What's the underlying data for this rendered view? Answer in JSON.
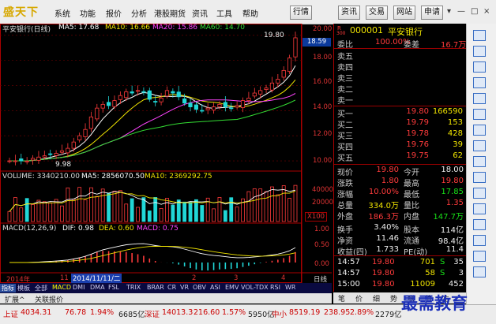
{
  "app": {
    "logo_text": "盛天下"
  },
  "menu": [
    "系统",
    "功能",
    "报价",
    "分析",
    "港股期货",
    "资讯",
    "工具",
    "帮助"
  ],
  "toolbar": [
    "行情",
    "资讯",
    "交易",
    "网站",
    "申请"
  ],
  "window_controls": [
    "▾",
    "—",
    "□",
    "×"
  ],
  "chart": {
    "title": "平安银行(日线)",
    "ma": [
      {
        "label": "MA5: 17.68",
        "color": "#ffffff"
      },
      {
        "label": "MA10: 16.66",
        "color": "#f0e400"
      },
      {
        "label": "MA20: 15.86",
        "color": "#ff44ff"
      },
      {
        "label": "MA60: 14.70",
        "color": "#33dd33"
      }
    ],
    "y_ticks": [
      "20.00",
      "18.00",
      "16.00",
      "14.00",
      "12.00",
      "10.00"
    ],
    "current_price_tag": "18.59",
    "high_mark": "19.80",
    "low_mark": "9.98",
    "volume_title": "VOLUME: 3340210.00",
    "volume_ma5": "MA5: 2856070.50",
    "volume_ma10": "MA10: 2369292.75",
    "volume_ticks": [
      "40000",
      "20000",
      "X100"
    ],
    "macd_title": "MACD(12,26,9)",
    "macd_dif": "DIF: 0.98",
    "macd_dea": "DEA: 0.60",
    "macd_val": "MACD: 0.75",
    "macd_ticks": [
      "1.00",
      "0.50",
      "0.00"
    ],
    "date_axis": [
      "2014年",
      "11",
      "2014/11/11/二",
      "2",
      "3",
      "4",
      "日线"
    ],
    "closes": [
      10.0,
      10.0,
      10.0,
      9.98,
      10.2,
      10.3,
      10.4,
      10.5,
      10.6,
      10.8,
      11.0,
      11.5,
      12.0,
      12.5,
      13.5,
      14.2,
      14.5,
      14.4,
      14.8,
      15.2,
      15.5,
      15.4,
      15.6,
      15.5,
      14.9,
      14.7,
      15.0,
      15.6,
      15.4,
      15.1,
      14.6,
      14.3,
      14.1,
      14.0,
      14.2,
      14.3,
      14.5,
      14.3,
      14.2,
      14.4,
      14.8,
      15.0,
      15.4,
      15.6,
      15.8,
      16.2,
      16.5,
      17.2,
      18.2,
      19.8
    ]
  },
  "tabs_bottom": [
    "指标",
    "模板",
    "全部",
    "MACD",
    "DMI",
    "DMA",
    "FSL",
    "TRIX",
    "BRAR",
    "CR",
    "VR",
    "OBV",
    "ASI",
    "EMV",
    "VOL-TDX",
    "RSI",
    "WR"
  ],
  "subtabs": [
    "扩展^",
    "关联报价"
  ],
  "quote": {
    "ratio_label": "委比",
    "ratio_value": "100.00%",
    "diff_label": "委差",
    "diff_value": "16.7万",
    "code_mark": "R",
    "code_num": "300",
    "code": "000001",
    "name": "平安银行",
    "sells": [
      {
        "label": "卖五"
      },
      {
        "label": "卖四"
      },
      {
        "label": "卖三"
      },
      {
        "label": "卖二"
      },
      {
        "label": "卖一"
      }
    ],
    "buys": [
      {
        "label": "买一",
        "price": "19.80",
        "vol": "166590"
      },
      {
        "label": "买二",
        "price": "19.79",
        "vol": "153"
      },
      {
        "label": "买三",
        "price": "19.78",
        "vol": "428"
      },
      {
        "label": "买四",
        "price": "19.76",
        "vol": "39"
      },
      {
        "label": "买五",
        "price": "19.75",
        "vol": "62"
      }
    ],
    "stats": [
      {
        "l1": "现价",
        "v1": "19.80",
        "c1": "red",
        "l2": "今开",
        "v2": "18.00",
        "c2": "wht"
      },
      {
        "l1": "涨跌",
        "v1": "1.80",
        "c1": "red",
        "l2": "最高",
        "v2": "19.80",
        "c2": "red"
      },
      {
        "l1": "涨幅",
        "v1": "10.00%",
        "c1": "red",
        "l2": "最低",
        "v2": "17.85",
        "c2": "grn"
      },
      {
        "l1": "总量",
        "v1": "334.0万",
        "c1": "yel",
        "l2": "量比",
        "v2": "1.35",
        "c2": "red"
      },
      {
        "l1": "外盘",
        "v1": "186.3万",
        "c1": "red",
        "l2": "内盘",
        "v2": "147.7万",
        "c2": "grn"
      },
      {
        "l1": "换手",
        "v1": "3.40%",
        "c1": "wht",
        "l2": "股本",
        "v2": "114亿",
        "c2": "wht"
      },
      {
        "l1": "净资",
        "v1": "11.46",
        "c1": "wht",
        "l2": "流通",
        "v2": "98.4亿",
        "c2": "wht"
      },
      {
        "l1": "收益(四)",
        "v1": "1.733",
        "c1": "wht",
        "l2": "PE(动)",
        "v2": "11.4",
        "c2": "wht"
      }
    ],
    "ticks": [
      {
        "time": "14:57",
        "price": "19.80",
        "vol": "701",
        "flag": "S",
        "n": "35"
      },
      {
        "time": "14:57",
        "price": "19.80",
        "vol": "58",
        "flag": "S",
        "n": "3"
      },
      {
        "time": "15:00",
        "price": "19.80",
        "vol": "11009",
        "flag": "",
        "n": "452"
      }
    ],
    "bottom_tabs": [
      "笔",
      "价",
      "细",
      "势",
      "联",
      "值",
      "主"
    ]
  },
  "status": [
    {
      "label": "上证",
      "v": "4034.31",
      "c": "76.78",
      "p": "1.94%",
      "amt": "6685亿"
    },
    {
      "label": "深证",
      "v": "14013.3",
      "c": "216.60",
      "p": "1.57%",
      "amt": "5950亿"
    },
    {
      "label": "中小",
      "v": "8519.19",
      "c": "238.95",
      "p": "2.89%",
      "amt": "2279亿"
    }
  ],
  "watermark": "最需教育"
}
